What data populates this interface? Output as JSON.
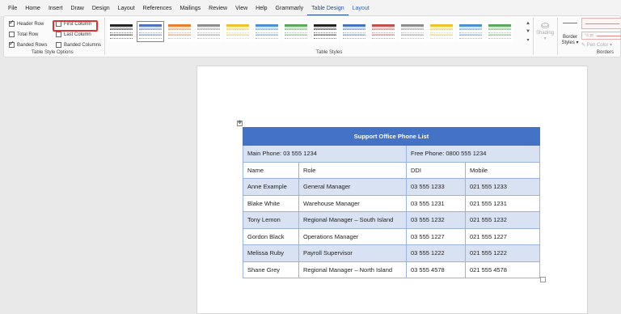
{
  "menu": {
    "tabs": [
      "File",
      "Home",
      "Insert",
      "Draw",
      "Design",
      "Layout",
      "References",
      "Mailings",
      "Review",
      "View",
      "Help",
      "Grammarly",
      "Table Design",
      "Layout"
    ],
    "active_index": 12,
    "contextual_indices": [
      12,
      13
    ]
  },
  "ribbon": {
    "style_options": {
      "header_row": {
        "label": "Header Row",
        "checked": true
      },
      "first_column": {
        "label": "First Column",
        "checked": false
      },
      "total_row": {
        "label": "Total Row",
        "checked": false
      },
      "last_column": {
        "label": "Last Column",
        "checked": false
      },
      "banded_rows": {
        "label": "Banded Rows",
        "checked": true
      },
      "banded_columns": {
        "label": "Banded Columns",
        "checked": false
      },
      "group_label": "Table Style Options"
    },
    "table_styles": {
      "group_label": "Table Styles",
      "swatch_colors": [
        "#222222",
        "#4f6fbf",
        "#e67e2e",
        "#8c8c8c",
        "#f2c12e",
        "#4a8fd0",
        "#5aa85a",
        "#222222",
        "#4472c4",
        "#c0504d",
        "#8c8c8c",
        "#f2c12e",
        "#4a8fd0",
        "#5aa85a"
      ],
      "selected_index": 1
    },
    "shading": {
      "label": "Shading"
    },
    "border_styles": {
      "label1": "Border",
      "label2": "Styles ▾"
    },
    "pen": {
      "size": "½ pt",
      "color_label": "Pen Color ▾"
    },
    "borders_group_label": "Borders"
  },
  "document": {
    "table": {
      "title": "Support Office Phone List",
      "main_phone": "Main Phone: 03 555 1234",
      "free_phone": "Free Phone: 0800 555 1234",
      "headers": [
        "Name",
        "Role",
        "DDI",
        "Mobile"
      ],
      "rows": [
        [
          "Anne Example",
          "General Manager",
          "03 555 1233",
          "021 555 1233"
        ],
        [
          "Blake White",
          "Warehouse Manager",
          "03 555 1231",
          "021 555 1231"
        ],
        [
          "Tony Lemon",
          "Regional Manager – South Island",
          "03 555 1232",
          "021 555 1232"
        ],
        [
          "Gordon Black",
          "Operations Manager",
          "03 555 1227",
          "021 555 1227"
        ],
        [
          "Melissa Ruby",
          "Payroll Supervisor",
          "03 555 1222",
          "021 555 1222"
        ],
        [
          "Shane Grey",
          "Regional Manager – North Island",
          "03 555 4578",
          "021 555 4578"
        ]
      ]
    }
  }
}
